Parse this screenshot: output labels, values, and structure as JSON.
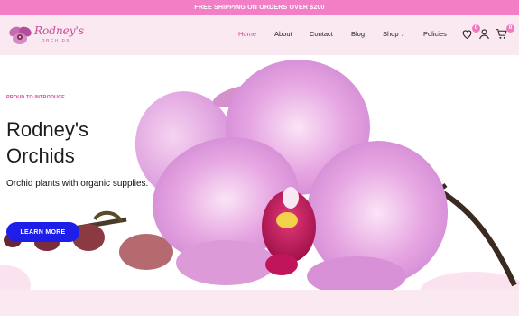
{
  "promo": {
    "text": "FREE SHIPPING ON ORDERS OVER $200"
  },
  "brand": {
    "name": "Rodney's",
    "tagline": "ORCHIDS"
  },
  "nav": {
    "items": [
      {
        "label": "Home",
        "active": true
      },
      {
        "label": "About"
      },
      {
        "label": "Contact"
      },
      {
        "label": "Blog"
      },
      {
        "label": "Shop",
        "dropdown": true
      },
      {
        "label": "Policies"
      }
    ]
  },
  "header_icons": {
    "wishlist": {
      "icon": "heart-icon",
      "count": "0"
    },
    "account": {
      "icon": "user-icon"
    },
    "cart": {
      "icon": "cart-icon",
      "count": "0"
    }
  },
  "hero": {
    "eyebrow": "PROUD TO INTRODUCE",
    "title": "Rodney's Orchids",
    "subtitle": "Orchid plants with organic supplies.",
    "cta_label": "LEARN MORE"
  },
  "colors": {
    "promo_bg": "#f27ec6",
    "header_bg": "#fbe9f2",
    "nav_active": "#e0479b",
    "cta_bg": "#1d1ee8",
    "badge": "#f47ac0"
  }
}
